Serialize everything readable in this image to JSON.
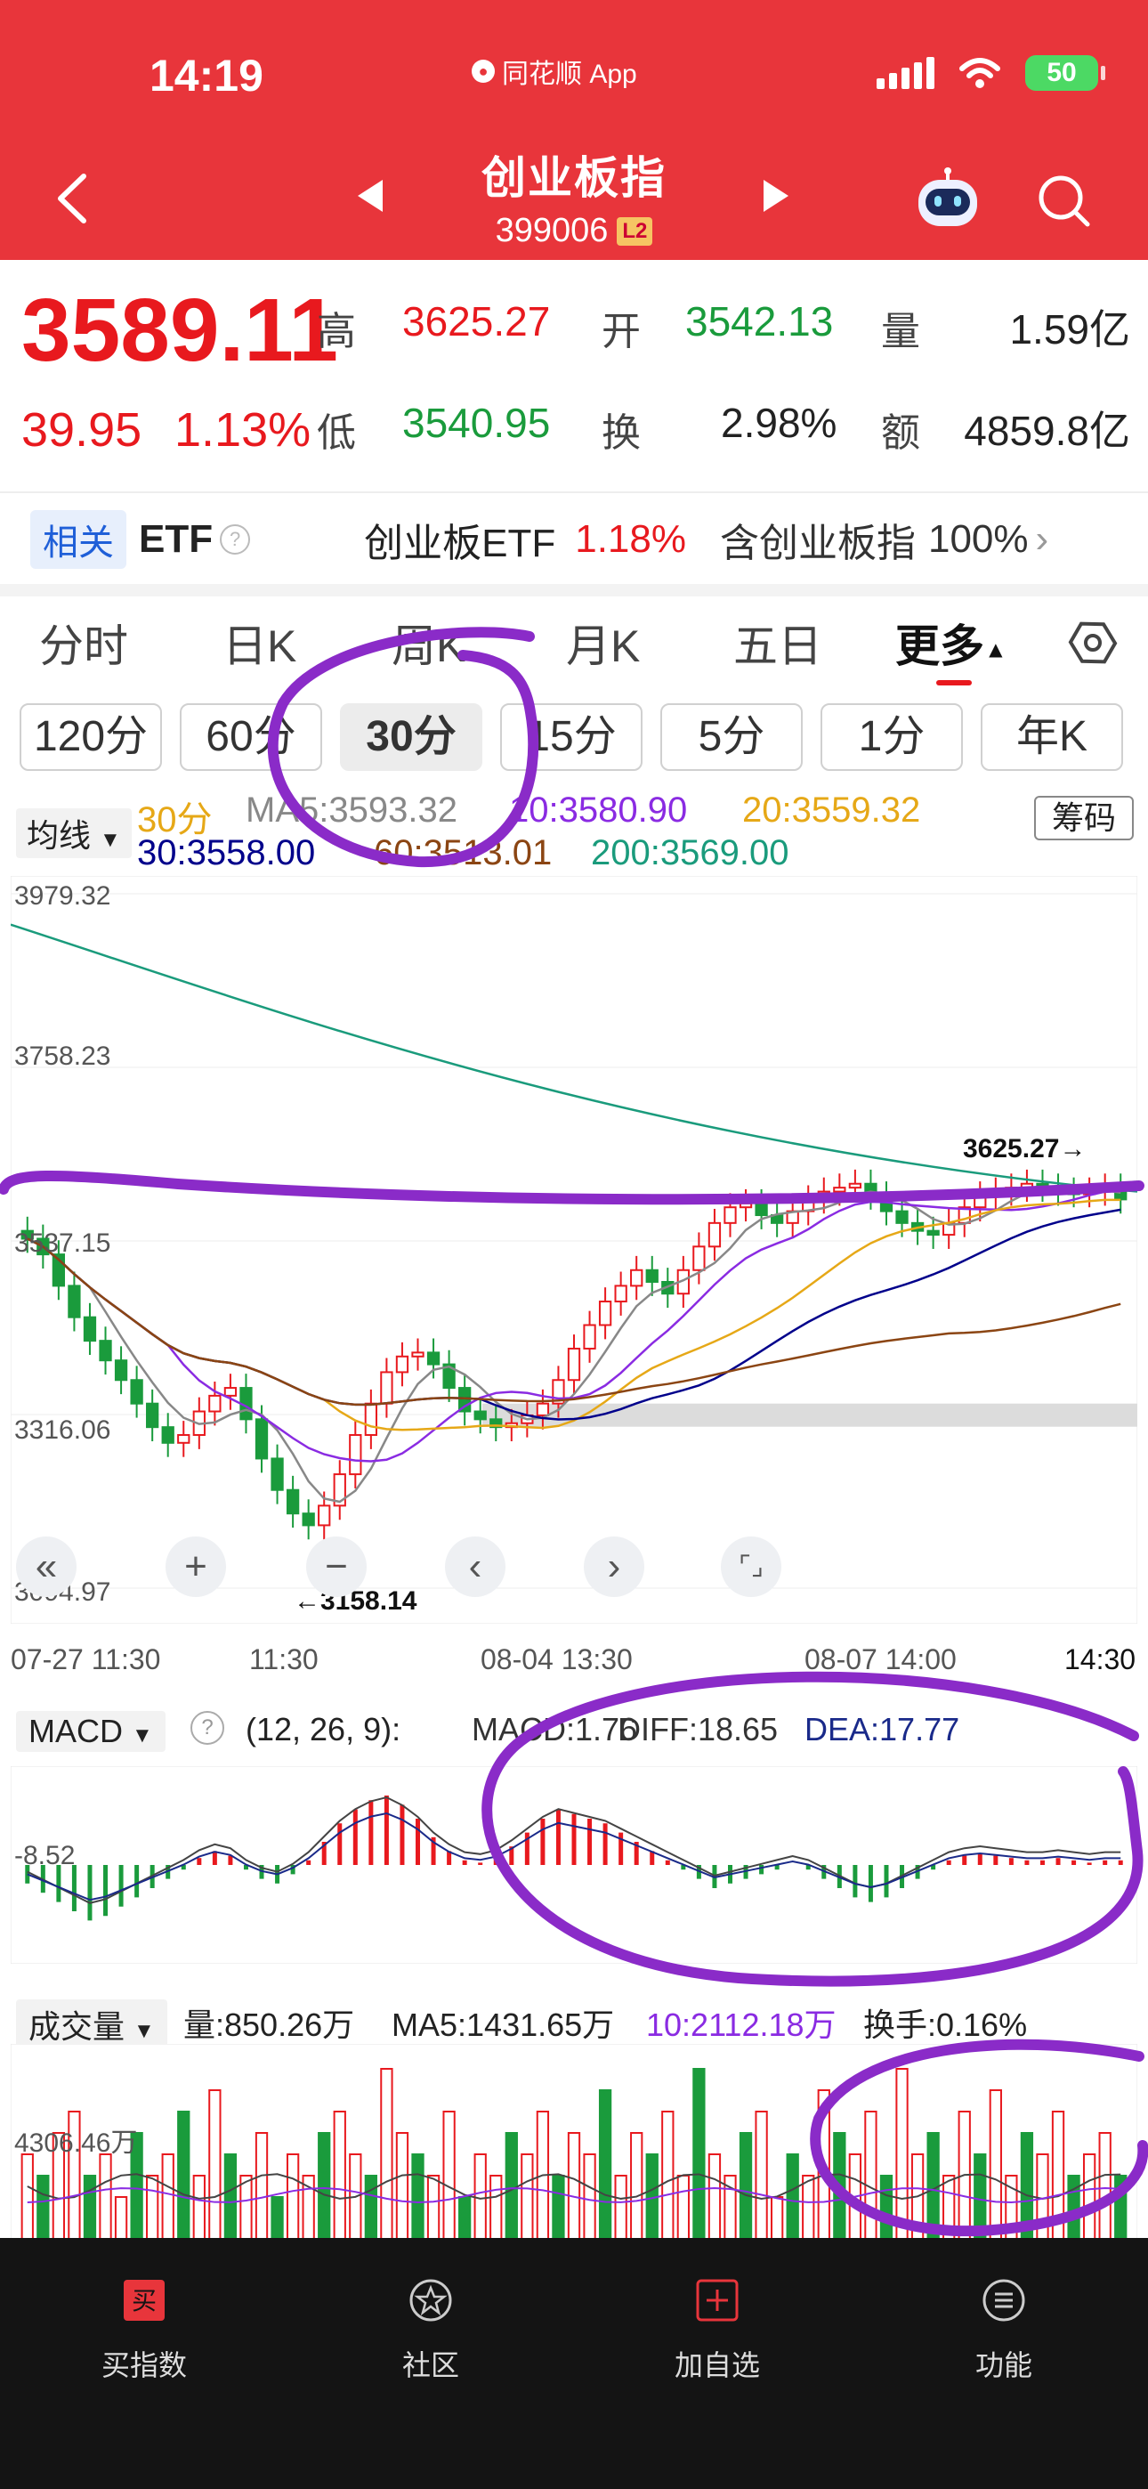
{
  "status": {
    "time": "14:19",
    "app": "同花顺 App",
    "battery": "50"
  },
  "header": {
    "title": "创业板指",
    "code": "399006",
    "level": "L2"
  },
  "quote": {
    "price": "3589.11",
    "change": "39.95",
    "change_pct": "1.13%",
    "labels": {
      "high": "高",
      "open": "开",
      "volume": "量",
      "low": "低",
      "turnover": "换",
      "amount": "额"
    },
    "high": "3625.27",
    "open": "3542.13",
    "volume": "1.59亿",
    "low": "3540.95",
    "turnover": "2.98%",
    "amount": "4859.8亿"
  },
  "etf": {
    "tag": "相关",
    "name": "ETF",
    "fund": "创业板ETF",
    "fund_pct": "1.18%",
    "includes": "含创业板指",
    "weight": "100%"
  },
  "tabs": [
    "分时",
    "日K",
    "周K",
    "月K",
    "五日",
    "更多"
  ],
  "active_tab": "更多",
  "subtabs": [
    "120分",
    "60分",
    "30分",
    "15分",
    "5分",
    "1分",
    "年K"
  ],
  "selected_subtab": "30分",
  "ma": {
    "selector": "均线",
    "period": "30分",
    "chips": "筹码",
    "ma5": "MA5:3593.32",
    "ma10": "10:3580.90",
    "ma20": "20:3559.32",
    "ma30": "30:3558.00",
    "ma60": "60:3513.01",
    "ma200": "200:3569.00"
  },
  "colors": {
    "red": "#e8191e",
    "green": "#1a9b3c",
    "ma5": "#888888",
    "ma10": "#8a2be2",
    "ma20": "#e6a817",
    "ma30": "#00008b",
    "ma60": "#8b4513",
    "ma200": "#1a9b7c",
    "annotation": "#8a2bc8"
  },
  "price_axis": [
    "3979.32",
    "3758.23",
    "3537.15",
    "3316.06",
    "3094.97"
  ],
  "annotations": {
    "high_mark": "3625.27→",
    "low_mark": "←3158.14"
  },
  "time_axis": [
    "07-27 11:30",
    "11:30",
    "08-04 13:30",
    "08-07 14:00",
    "14:30"
  ],
  "macd": {
    "selector": "MACD",
    "params": "(12, 26, 9):",
    "macd": "MACD:1.76",
    "diff": "DIFF:18.65",
    "dea": "DEA:17.77",
    "axis_label": "-8.52"
  },
  "volume": {
    "selector": "成交量",
    "vol": "量:850.26万",
    "ma5": "MA5:1431.65万",
    "ma10": "10:2112.18万",
    "turnover": "换手:0.16%",
    "axis_label": "4306.46万"
  },
  "bottom_nav": [
    "买指数",
    "社区",
    "加自选",
    "功能"
  ],
  "chart_data": {
    "type": "candlestick",
    "title": "创业板指 30分",
    "ylim": [
      3094.97,
      3979.32
    ],
    "y_ticks": [
      3979.32,
      3758.23,
      3537.15,
      3316.06,
      3094.97
    ],
    "x_labels": [
      "07-27 11:30",
      "11:30",
      "08-04 13:30",
      "08-07 14:00",
      "14:30"
    ],
    "high": 3625.27,
    "low": 3158.14,
    "close_series": [
      3540,
      3520,
      3480,
      3440,
      3410,
      3385,
      3360,
      3330,
      3300,
      3280,
      3290,
      3320,
      3340,
      3350,
      3310,
      3260,
      3220,
      3190,
      3175,
      3200,
      3240,
      3290,
      3330,
      3370,
      3390,
      3395,
      3380,
      3350,
      3320,
      3310,
      3300,
      3305,
      3315,
      3330,
      3360,
      3400,
      3430,
      3460,
      3480,
      3500,
      3485,
      3470,
      3500,
      3530,
      3560,
      3580,
      3585,
      3570,
      3560,
      3575,
      3590,
      3600,
      3605,
      3610,
      3595,
      3575,
      3560,
      3550,
      3545,
      3560,
      3580,
      3595,
      3600,
      3605,
      3610,
      3605,
      3600,
      3598,
      3600,
      3605,
      3590
    ],
    "ma_lines": [
      "MA5",
      "MA10",
      "MA20",
      "MA30",
      "MA60",
      "MA200"
    ],
    "macd_values": [
      -8,
      -12,
      -16,
      -20,
      -24,
      -22,
      -18,
      -14,
      -10,
      -6,
      -2,
      3,
      6,
      4,
      -2,
      -6,
      -8,
      -4,
      2,
      10,
      18,
      24,
      28,
      30,
      26,
      20,
      12,
      6,
      2,
      1,
      3,
      8,
      14,
      20,
      24,
      22,
      20,
      18,
      14,
      10,
      6,
      2,
      -2,
      -6,
      -10,
      -8,
      -6,
      -4,
      -2,
      0,
      -2,
      -6,
      -10,
      -14,
      -16,
      -14,
      -10,
      -6,
      -2,
      2,
      4,
      5,
      4,
      3,
      2,
      2,
      3,
      2,
      1,
      2,
      2
    ],
    "volume_values": [
      4,
      3,
      5,
      6,
      3,
      4,
      2,
      5,
      3,
      4,
      6,
      3,
      7,
      4,
      3,
      5,
      2,
      4,
      3,
      5,
      6,
      4,
      3,
      8,
      5,
      4,
      3,
      6,
      2,
      4,
      3,
      5,
      4,
      6,
      3,
      5,
      4,
      7,
      3,
      5,
      4,
      6,
      3,
      8,
      4,
      3,
      5,
      6,
      2,
      4,
      3,
      7,
      5,
      4,
      6,
      3,
      8,
      4,
      5,
      3,
      6,
      4,
      7,
      3,
      5,
      4,
      6,
      3,
      4,
      5,
      3
    ]
  }
}
